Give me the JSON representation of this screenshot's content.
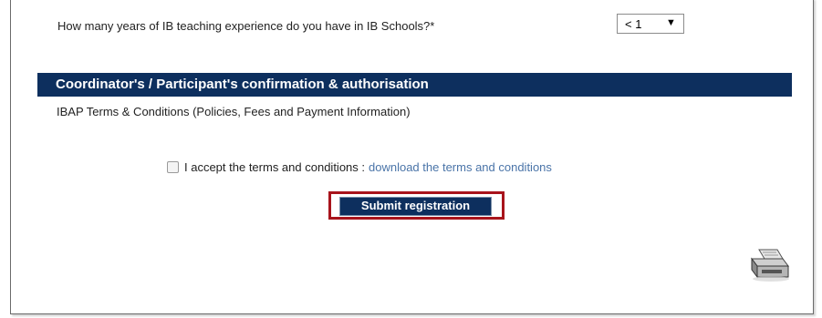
{
  "experience": {
    "question": "How many years of IB teaching experience do you have in IB Schools?*",
    "selected": "< 1",
    "caret": "▼"
  },
  "section": {
    "title": "Coordinator's / Participant's confirmation & authorisation",
    "terms_line": "IBAP Terms & Conditions (Policies, Fees and Payment Information)"
  },
  "accept": {
    "label": "I accept the terms and conditions :",
    "link": "download the terms and conditions"
  },
  "submit": {
    "label": "Submit registration"
  },
  "icons": {
    "print": "printer-icon"
  },
  "colors": {
    "header_bg": "#0d2f5e",
    "highlight": "#a8141c",
    "link": "#4a74a8"
  }
}
